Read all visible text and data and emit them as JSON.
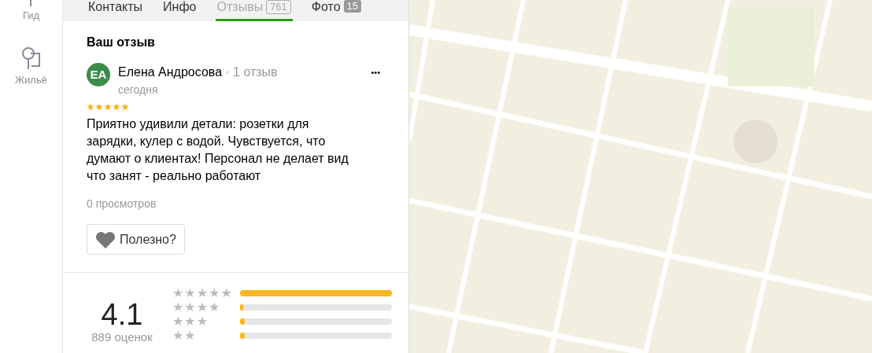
{
  "sidebar": {
    "items": [
      {
        "label": "Гид"
      },
      {
        "label": "Жильё"
      }
    ]
  },
  "tabs": [
    {
      "label": "Контакты",
      "selected": false
    },
    {
      "label": "Инфо",
      "selected": false
    },
    {
      "label": "Отзывы",
      "badge": "761",
      "selected": true
    },
    {
      "label": "Фото",
      "badge": "15",
      "selected": false
    }
  ],
  "review": {
    "heading": "Ваш отзыв",
    "author": {
      "initials": "ЕА",
      "name": "Елена Андросова",
      "review_count": "1 отзыв",
      "date": "сегодня"
    },
    "stars": 5,
    "text": "Приятно удивили детали: розетки для зарядки, кулер с водой. Чувствуется, что думают о клиентах! Персонал не делает вид что занят - реально работают",
    "views": "0 просмотров",
    "helpful_button": "Полезно?",
    "more": "•••"
  },
  "rating": {
    "score": "4.1",
    "count": "889 оценок",
    "distribution": [
      {
        "label": "★★★★★",
        "level": 1.0
      },
      {
        "label": "★★★★",
        "level": 0.02
      },
      {
        "label": "★★★",
        "level": 0.03
      },
      {
        "label": "★★",
        "level": 0.03
      }
    ]
  }
}
